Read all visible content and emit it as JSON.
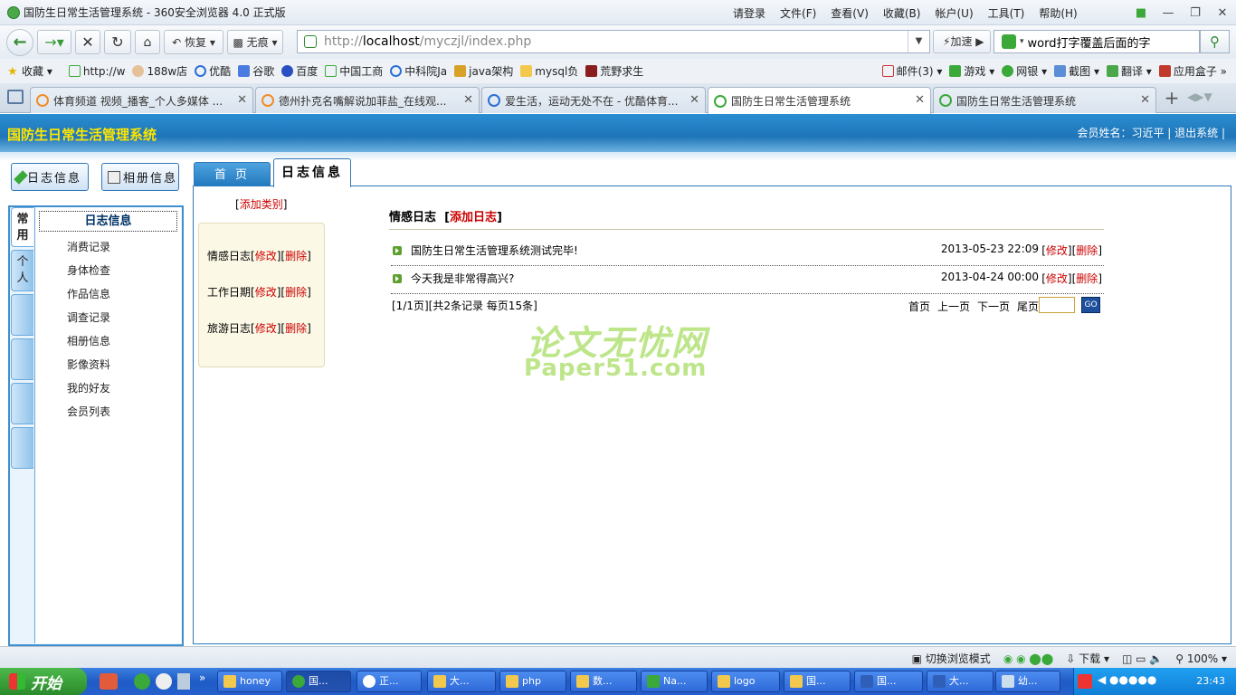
{
  "browser": {
    "title": "国防生日常生活管理系统 - 360安全浏览器 4.0 正式版",
    "menus": [
      "请登录",
      "文件(F)",
      "查看(V)",
      "收藏(B)",
      "帐户(U)",
      "工具(T)",
      "帮助(H)"
    ],
    "nav": {
      "restore": "恢复",
      "incognito": "无痕",
      "url_prefix": "http://",
      "url_host": "localhost",
      "url_path": "/myczjl/index.php",
      "accelerate": "加速",
      "search_value": "word打字覆盖后面的字"
    },
    "bookmarks": [
      "收藏",
      "http://w",
      "188w店",
      "优酷",
      "谷歌",
      "百度",
      "中国工商",
      "中科院Ja",
      "java架构",
      "mysql负",
      "荒野求生"
    ],
    "bookmarks_right": [
      "邮件(3)",
      "游戏",
      "网银",
      "截图",
      "翻译",
      "应用盒子"
    ],
    "tabs": [
      {
        "label": "体育频道 视频_播客_个人多媒体 ...",
        "fav": "#f28c28"
      },
      {
        "label": "德州扑克名嘴解说加菲盐_在线观...",
        "fav": "#f28c28"
      },
      {
        "label": "爱生活，运动无处不在 - 优酷体育...",
        "fav": "#2b6fd6"
      },
      {
        "label": "国防生日常生活管理系统",
        "fav": "#3aa93a"
      },
      {
        "label": "国防生日常生活管理系统",
        "fav": "#3aa93a"
      }
    ],
    "status": {
      "mode": "切换浏览模式",
      "download": "下载",
      "zoom": "100%"
    }
  },
  "site": {
    "title": "国防生日常生活管理系统",
    "member": "会员姓名：习近平 | 退出系统 |",
    "top_buttons": [
      "日志信息",
      "相册信息"
    ],
    "content_tabs": [
      "首 页",
      "日志信息"
    ],
    "left_tabs": [
      "常用",
      "个人"
    ],
    "left_items": [
      "日志信息",
      "消费记录",
      "身体检查",
      "作品信息",
      "调查记录",
      "相册信息",
      "影像资料",
      "我的好友",
      "会员列表"
    ],
    "add_category": "添加类别",
    "categories": [
      {
        "name": "情感日志",
        "edit": "修改",
        "del": "删除"
      },
      {
        "name": "工作日期",
        "edit": "修改",
        "del": "删除"
      },
      {
        "name": "旅游日志",
        "edit": "修改",
        "del": "删除"
      }
    ],
    "log_section": "情感日志",
    "add_log": "添加日志",
    "logs": [
      {
        "title": "国防生日常生活管理系统测试完毕!",
        "date": "2013-05-23 22:09",
        "edit": "修改",
        "del": "删除"
      },
      {
        "title": "今天我是非常得高兴?",
        "date": "2013-04-24 00:00",
        "edit": "修改",
        "del": "删除"
      }
    ],
    "page_info": "[1/1页][共2条记录 每页15条]",
    "pager": [
      "首页",
      "上一页",
      "下一页",
      "尾页"
    ],
    "go": "GO",
    "watermark_cn": "论文无忧网",
    "watermark_en": "Paper51.com"
  },
  "taskbar": {
    "start": "开始",
    "items": [
      "honey",
      "国...",
      "正...",
      "大...",
      "php",
      "数...",
      "Na...",
      "logo",
      "国...",
      "国...",
      "大...",
      "幼..."
    ],
    "clock": "23:43"
  }
}
